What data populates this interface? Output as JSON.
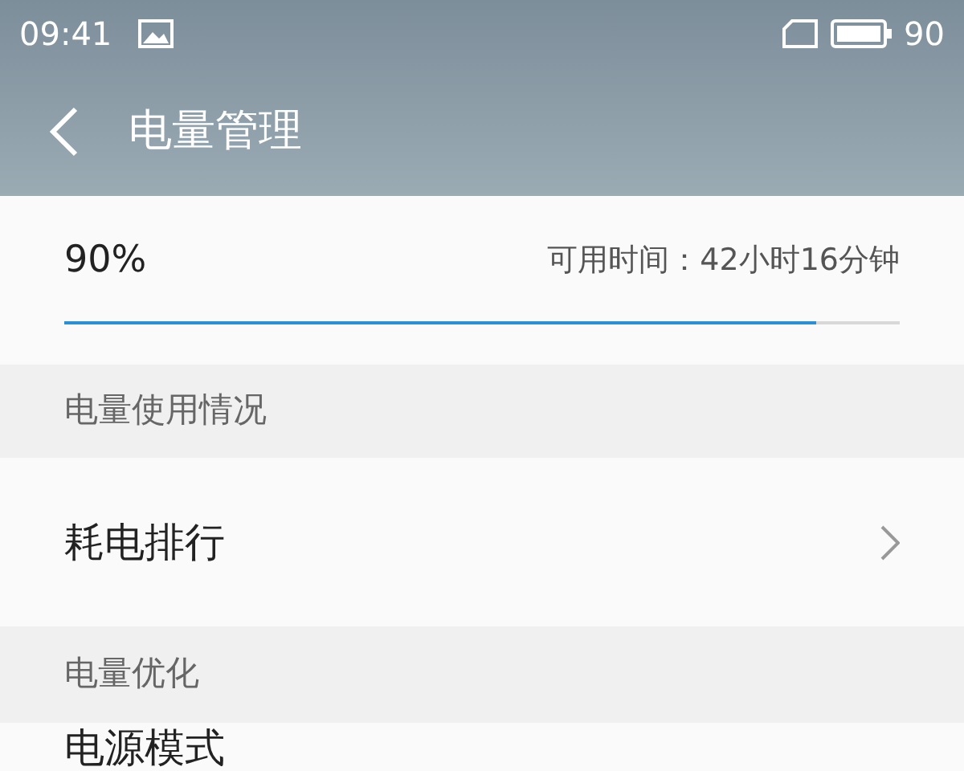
{
  "status_bar": {
    "time": "09:41",
    "battery_text": "90"
  },
  "header": {
    "title": "电量管理"
  },
  "battery": {
    "percent": "90%",
    "remaining": "可用时间：42小时16分钟",
    "level": 0.9
  },
  "sections": [
    {
      "title": "电量使用情况",
      "items": [
        {
          "label": "耗电排行",
          "chevron": true
        }
      ]
    },
    {
      "title": "电量优化",
      "items": [
        {
          "label": "电源模式",
          "chevron": false
        }
      ]
    }
  ]
}
